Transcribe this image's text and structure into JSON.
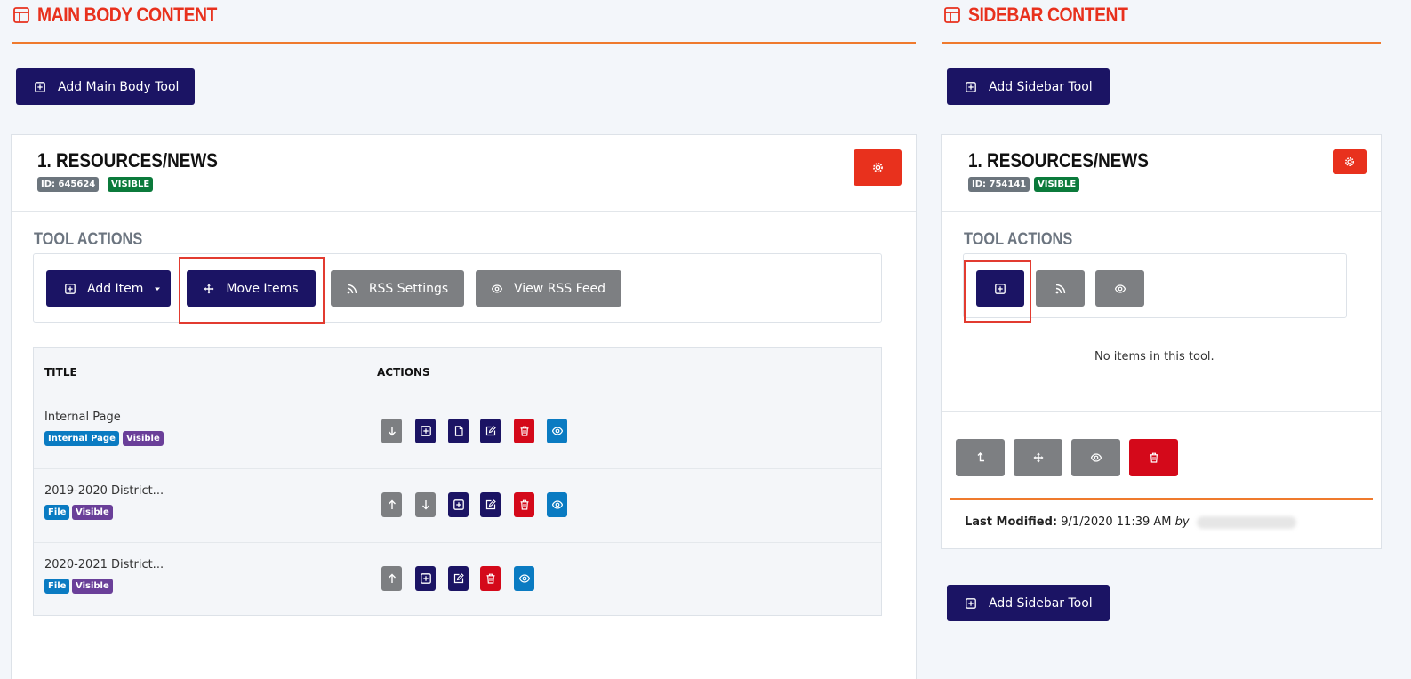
{
  "colors": {
    "accent": "#e8311d",
    "navy": "#1b1464",
    "rule": "#ef7a2d",
    "grey": "#7d7f82",
    "danger": "#d4091a",
    "info": "#0a7bc2"
  },
  "main": {
    "title": "MAIN BODY CONTENT",
    "add_tool_label": "Add Main Body Tool",
    "card": {
      "title": "1. RESOURCES/NEWS",
      "id_badge": "ID: 645624",
      "status_badge": "VISIBLE",
      "tool_actions_label": "TOOL ACTIONS",
      "buttons": {
        "add_item": "Add Item",
        "move_items": "Move Items",
        "rss_settings": "RSS Settings",
        "view_rss_feed": "View RSS Feed"
      },
      "table": {
        "headers": [
          "TITLE",
          "ACTIONS"
        ],
        "rows": [
          {
            "title": "Internal Page",
            "badges": [
              "Internal Page",
              "Visible"
            ],
            "actions": [
              "move-down-icon",
              "add-icon",
              "file-icon",
              "edit-icon",
              "delete-icon",
              "view-icon"
            ]
          },
          {
            "title": "2019-2020 District...",
            "badges": [
              "File",
              "Visible"
            ],
            "actions": [
              "move-up-icon",
              "move-down-icon",
              "add-icon",
              "edit-icon",
              "delete-icon",
              "view-icon"
            ]
          },
          {
            "title": "2020-2021 District...",
            "badges": [
              "File",
              "Visible"
            ],
            "actions": [
              "move-up-icon",
              "add-icon",
              "edit-icon",
              "delete-icon",
              "view-icon"
            ]
          }
        ]
      }
    }
  },
  "sidebar": {
    "title": "SIDEBAR CONTENT",
    "add_tool_label": "Add Sidebar Tool",
    "add_tool_label_bottom": "Add Sidebar Tool",
    "card": {
      "title": "1. RESOURCES/NEWS",
      "id_badge": "ID: 754141",
      "status_badge": "VISIBLE",
      "tool_actions_label": "TOOL ACTIONS",
      "empty_text": "No items in this tool.",
      "modified_label": "Last Modified:",
      "modified_value": "9/1/2020 11:39 AM",
      "modified_by": "by"
    }
  }
}
